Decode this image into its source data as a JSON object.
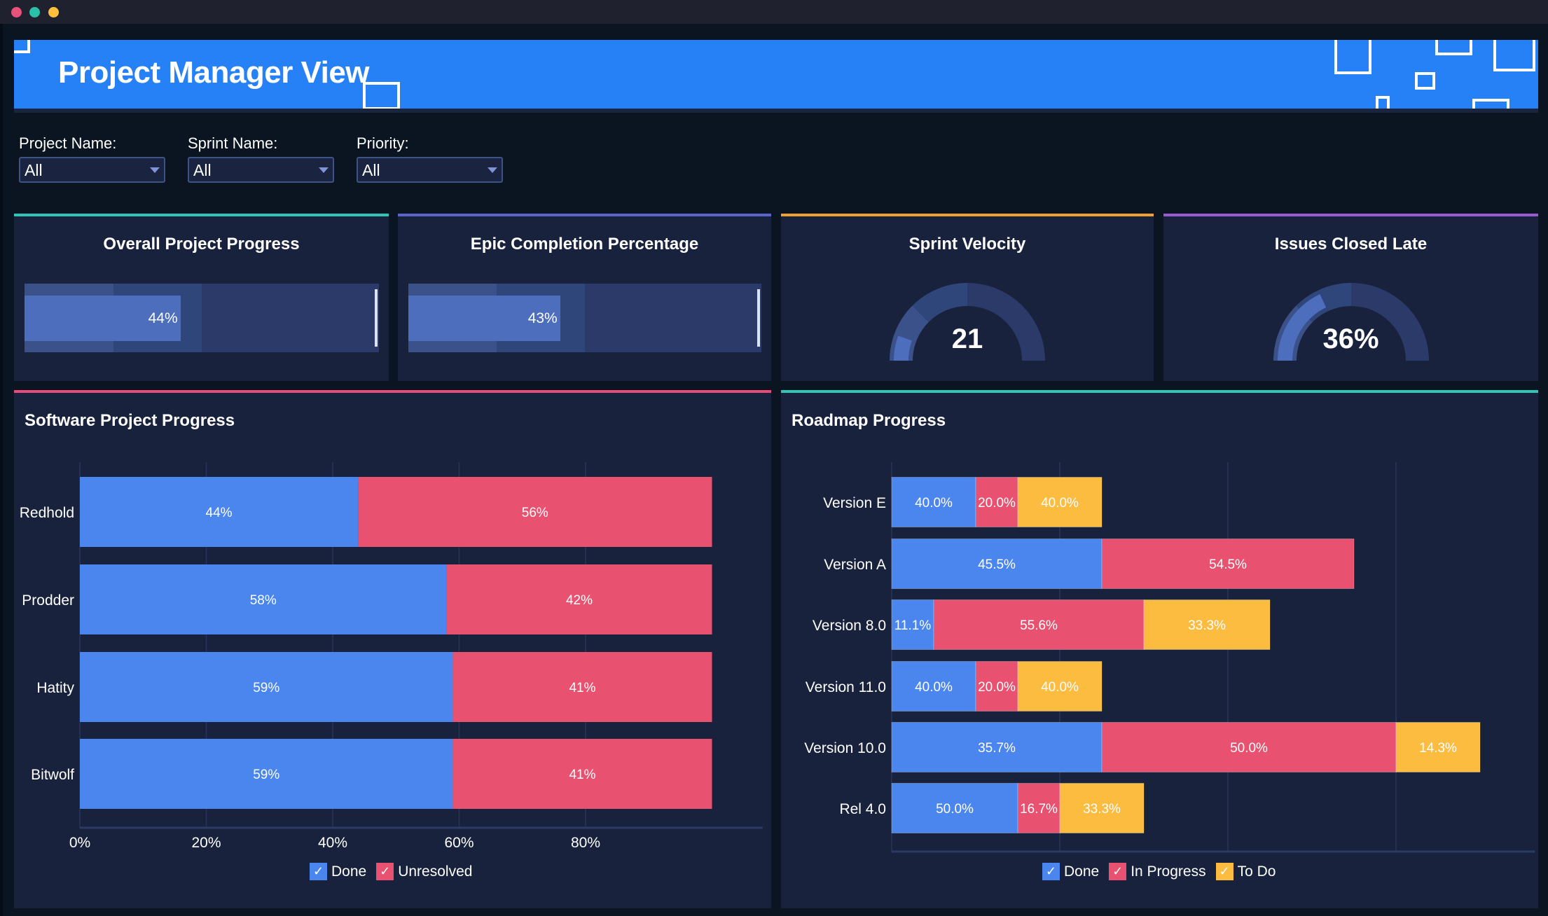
{
  "window": {
    "controls": [
      "close",
      "minimize",
      "maximize"
    ]
  },
  "header": {
    "title": "Project Manager View"
  },
  "filters": [
    {
      "label": "Project Name:",
      "value": "All"
    },
    {
      "label": "Sprint Name:",
      "value": "All"
    },
    {
      "label": "Priority:",
      "value": "All"
    }
  ],
  "colors": {
    "accent": "#2581f5",
    "done": "#4b86ef",
    "unresolved": "#e8516f",
    "in_progress": "#e8516f",
    "todo": "#fbbc40",
    "card_teal": "#2ec4b6",
    "card_indigo": "#5a63c9",
    "card_orange": "#f0a030",
    "card_purple": "#9b59d0",
    "panel_pink": "#e84a7a",
    "band_low": "#3a5189",
    "band_mid": "#2f467a",
    "band_high": "#2b3a68",
    "fill": "#4d6ebd",
    "target": "#dce3f5"
  },
  "kpis": {
    "overall_progress": {
      "title": "Overall Project Progress",
      "value": 44,
      "label": "44%",
      "bands": [
        25,
        50,
        100
      ],
      "target": 99.5
    },
    "epic_completion": {
      "title": "Epic Completion Percentage",
      "value": 43,
      "label": "43%",
      "bands": [
        25,
        50,
        100
      ],
      "target": 99.5
    },
    "sprint_velocity": {
      "title": "Sprint Velocity",
      "value": 21,
      "label": "21",
      "fill_fraction": 0.11,
      "bands": [
        0.25,
        0.5,
        1.0
      ]
    },
    "issues_closed_late": {
      "title": "Issues Closed Late",
      "value": 36,
      "label": "36%",
      "fill_fraction": 0.36,
      "bands": [
        0.25,
        0.5,
        1.0
      ]
    }
  },
  "software_panel": {
    "title": "Software Project Progress"
  },
  "roadmap_panel": {
    "title": "Roadmap Progress"
  },
  "chart_data": [
    {
      "id": "software-project-progress",
      "type": "bar",
      "orientation": "horizontal",
      "stacked": "percent",
      "title": "Software Project Progress",
      "categories": [
        "Redhold",
        "Prodder",
        "Hatity",
        "Bitwolf"
      ],
      "series": [
        {
          "name": "Done",
          "color": "#4b86ef",
          "values": [
            44,
            58,
            59,
            59
          ],
          "labels": [
            "44%",
            "58%",
            "59%",
            "59%"
          ]
        },
        {
          "name": "Unresolved",
          "color": "#e8516f",
          "values": [
            56,
            42,
            41,
            41
          ],
          "labels": [
            "56%",
            "42%",
            "41%",
            "41%"
          ]
        }
      ],
      "xlim": [
        0,
        108
      ],
      "xticks": [
        0,
        20,
        40,
        60,
        80
      ],
      "xtick_labels": [
        "0%",
        "20%",
        "40%",
        "60%",
        "80%"
      ],
      "grid": true,
      "legend": "bottom-center"
    },
    {
      "id": "roadmap-progress",
      "type": "bar",
      "orientation": "horizontal",
      "stacked": "count",
      "title": "Roadmap Progress",
      "categories": [
        "Version E",
        "Version A",
        "Version 8.0",
        "Version 11.0",
        "Version 10.0",
        "Rel 4.0"
      ],
      "series": [
        {
          "name": "Done",
          "color": "#4b86ef",
          "values": [
            2,
            5,
            1,
            2,
            5,
            3
          ],
          "labels": [
            "40.0%",
            "45.5%",
            "11.1%",
            "40.0%",
            "35.7%",
            "50.0%"
          ]
        },
        {
          "name": "In Progress",
          "color": "#e8516f",
          "values": [
            1,
            6,
            5,
            1,
            7,
            1
          ],
          "labels": [
            "20.0%",
            "54.5%",
            "55.6%",
            "20.0%",
            "50.0%",
            "16.7%"
          ]
        },
        {
          "name": "To Do",
          "color": "#fbbc40",
          "values": [
            2,
            0,
            3,
            2,
            2,
            2
          ],
          "labels": [
            "40.0%",
            "",
            "33.3%",
            "40.0%",
            "14.3%",
            "33.3%"
          ]
        }
      ],
      "xlim": [
        0,
        15.3
      ],
      "gridlines": [
        0,
        4,
        8,
        12
      ],
      "xtick_labels": [],
      "grid": true,
      "legend": "bottom-center"
    }
  ]
}
